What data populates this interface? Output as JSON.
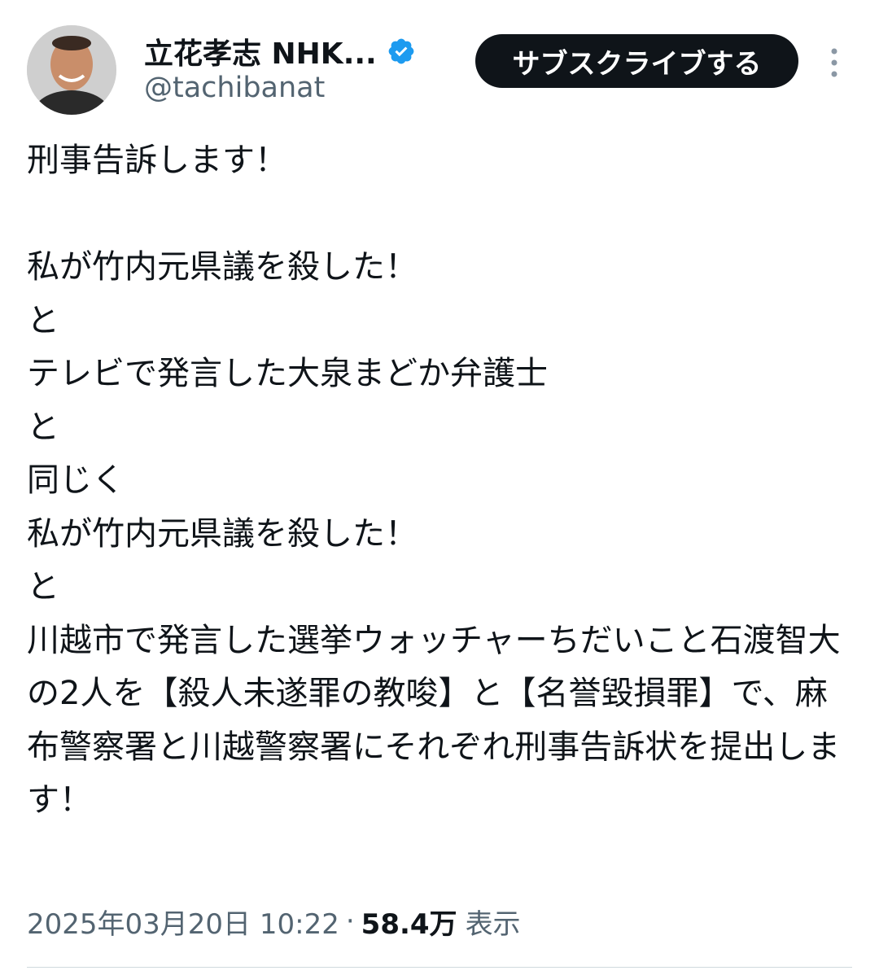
{
  "author": {
    "display_name": "立花孝志 NHK...",
    "handle": "@tachibanat",
    "verified": true,
    "accent_color": "#1d9bf0"
  },
  "actions": {
    "subscribe_label": "サブスクライブする",
    "more_icon": "more-vertical-icon"
  },
  "tweet": {
    "text": "刑事告訴します！\n\n私が竹内元県議を殺した！\nと\nテレビで発言した大泉まどか弁護士\nと\n同じく\n私が竹内元県議を殺した！\nと\n川越市で発言した選挙ウォッチャーちだいこと石渡智大\nの2人を【殺人未遂罪の教唆】と【名誉毀損罪】で、麻布警察署と川越警察署にそれぞれ刑事告訴状を提出します！",
    "timestamp": "2025年03月20日 10:22",
    "separator": "·",
    "views_count": "58.4万",
    "views_label": "表示"
  }
}
